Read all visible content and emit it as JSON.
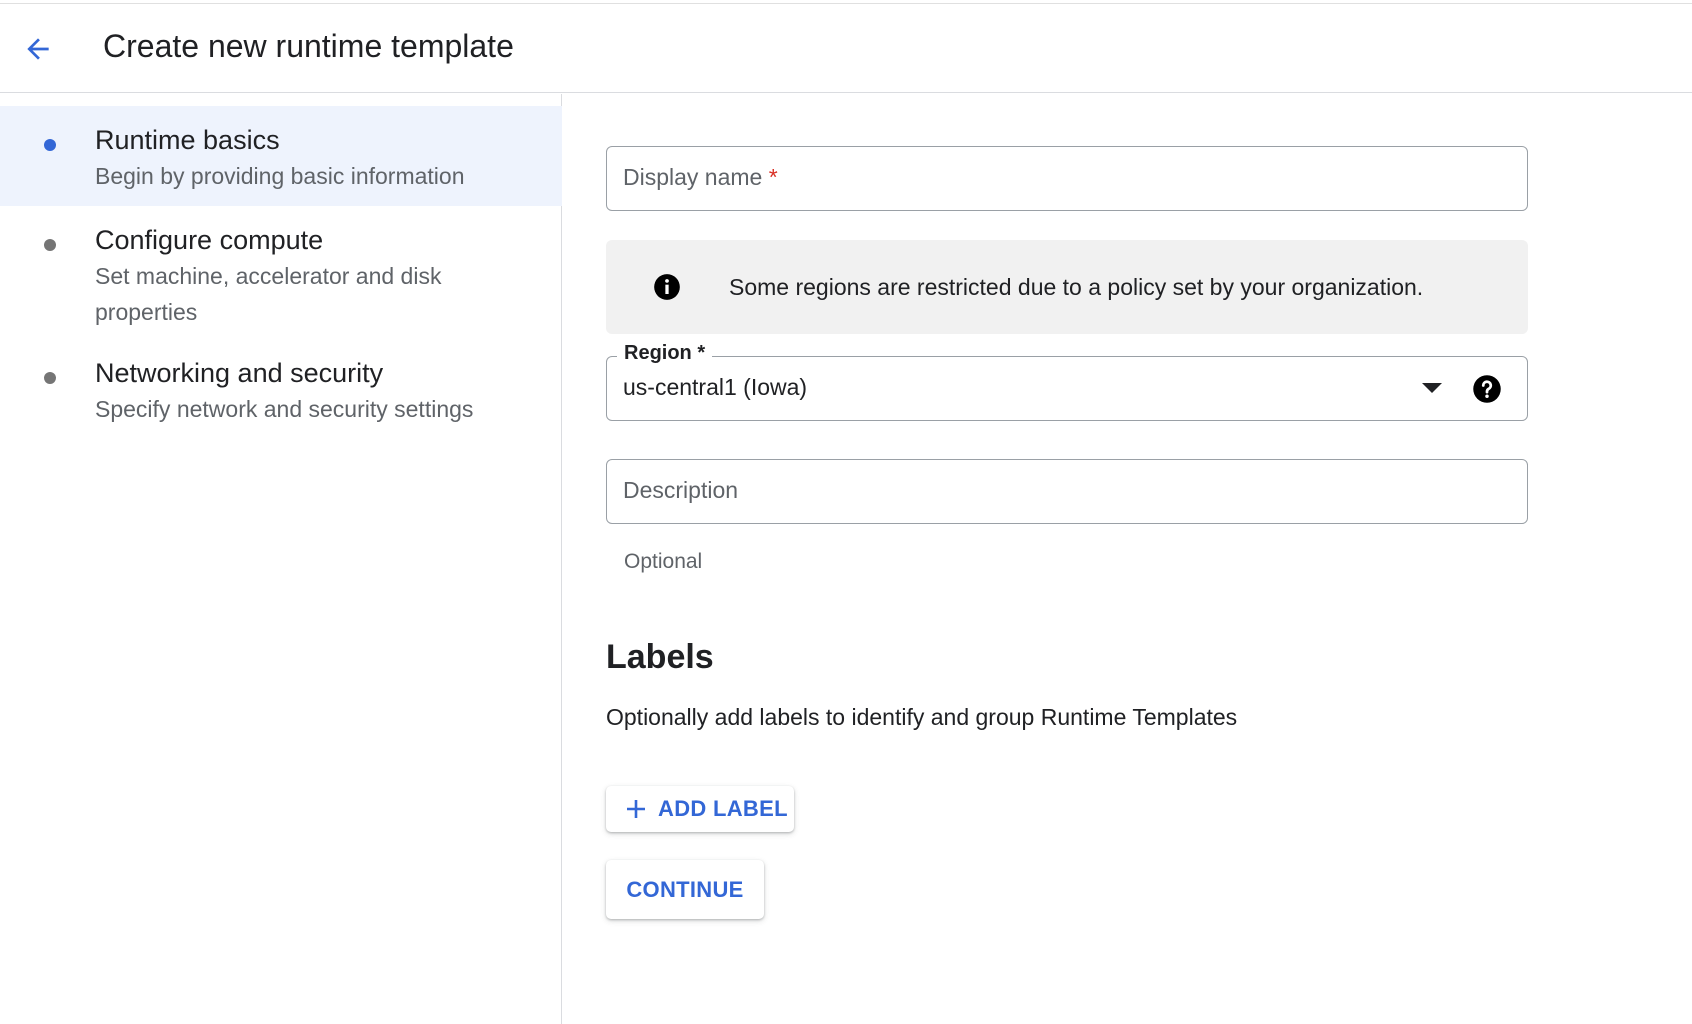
{
  "header": {
    "title": "Create new runtime template"
  },
  "steps": [
    {
      "title": "Runtime basics",
      "subtitle": "Begin by providing basic information",
      "active": true
    },
    {
      "title": "Configure compute",
      "subtitle": "Set machine, accelerator and disk properties",
      "active": false
    },
    {
      "title": "Networking and security",
      "subtitle": "Specify network and security settings",
      "active": false
    }
  ],
  "form": {
    "display_name_placeholder": "Display name",
    "required_mark": "*",
    "banner_text": "Some regions are restricted due to a policy set by your organization.",
    "region_label": "Region *",
    "region_value": "us-central1 (Iowa)",
    "description_placeholder": "Description",
    "description_hint": "Optional"
  },
  "labels_section": {
    "heading": "Labels",
    "description": "Optionally add labels to identify and group Runtime Templates",
    "add_label_button": "ADD LABEL"
  },
  "actions": {
    "continue_button": "CONTINUE"
  },
  "colors": {
    "accent": "#3367d6",
    "active_step_bg": "#eef3fd",
    "banner_bg": "#f1f1f1",
    "required": "#d93025"
  },
  "icons": {
    "back": "arrow-back-icon",
    "info": "info-icon",
    "dropdown": "dropdown-arrow-icon",
    "help": "help-icon",
    "add": "plus-icon"
  }
}
